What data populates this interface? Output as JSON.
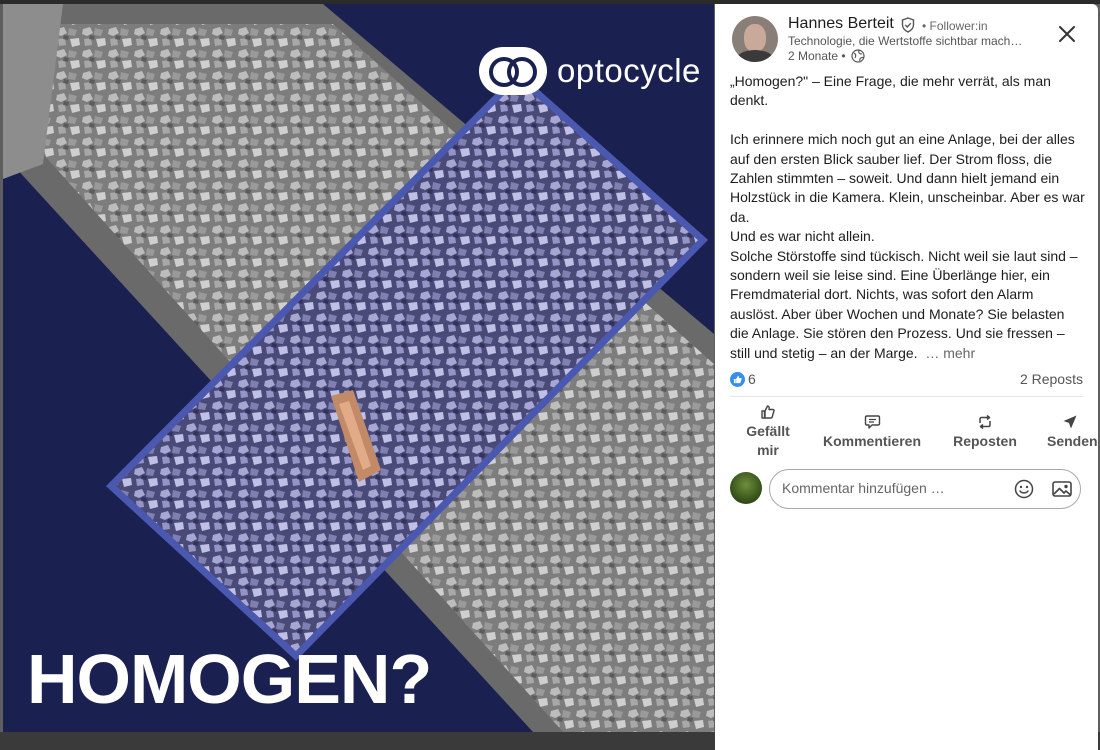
{
  "image": {
    "logo_text": "optocycle",
    "headline": "HOMOGEN?"
  },
  "author": {
    "name": "Hannes Berteit",
    "follower_label": "• Follower:in",
    "headline": "Technologie, die Wertstoffe sichtbar mach…",
    "time": "2 Monate •"
  },
  "post": {
    "paragraphs": [
      "„Homogen?\" – Eine Frage, die mehr verrät, als man denkt.",
      "",
      "Ich erinnere mich noch gut an eine Anlage, bei der alles auf den ersten Blick sauber lief. Der Strom floss, die Zahlen stimmten – soweit. Und dann hielt jemand ein Holzstück in die Kamera. Klein, unscheinbar. Aber es war da.",
      "Und es war nicht allein.",
      "Solche Störstoffe sind tückisch. Nicht weil sie laut sind – sondern weil sie leise sind. Eine Überlänge hier, ein Fremdmaterial dort. Nichts, was sofort den Alarm auslöst. Aber über Wochen und Monate? Sie belasten die Anlage. Sie stören den Prozess. Und sie fressen – still und stetig – an der Marge."
    ],
    "more_label": "… mehr"
  },
  "social": {
    "reactions_count": "6",
    "reposts": "2 Reposts"
  },
  "actions": {
    "like": "Gefällt mir",
    "comment": "Kommentieren",
    "repost": "Reposten",
    "send": "Senden"
  },
  "comment": {
    "placeholder": "Kommentar hinzufügen …"
  },
  "colors": {
    "image_background": "#1a2150",
    "frame_stroke": "#4a58b0",
    "like_blue": "#378fe9"
  }
}
